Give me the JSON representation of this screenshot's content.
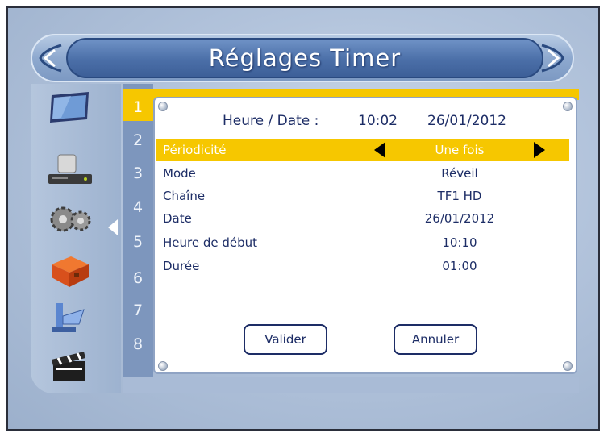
{
  "screen": {
    "title": "Réglages Timer"
  },
  "sidebar": {
    "icons": [
      "tv-screen-icon",
      "receiver-icon",
      "gears-icon",
      "toolbox-icon",
      "satellite-dish-icon",
      "clapperboard-icon"
    ]
  },
  "timer_slots": [
    "1",
    "2",
    "3",
    "4",
    "5",
    "6",
    "7",
    "8"
  ],
  "panel": {
    "header_label": "Heure / Date :",
    "header_time": "10:02",
    "header_date": "26/01/2012",
    "rows": [
      {
        "label": "Périodicité",
        "value": "Une fois"
      },
      {
        "label": "Mode",
        "value": "Réveil"
      },
      {
        "label": "Chaîne",
        "value": "TF1 HD"
      },
      {
        "label": "Date",
        "value": "26/01/2012"
      },
      {
        "label": "Heure de début",
        "value": "10:10"
      },
      {
        "label": "Durée",
        "value": "01:00"
      }
    ],
    "validate_label": "Valider",
    "cancel_label": "Annuler"
  },
  "colors": {
    "highlight": "#f6c700",
    "text": "#1d2d66",
    "title_bar": "#4b6fa8"
  }
}
